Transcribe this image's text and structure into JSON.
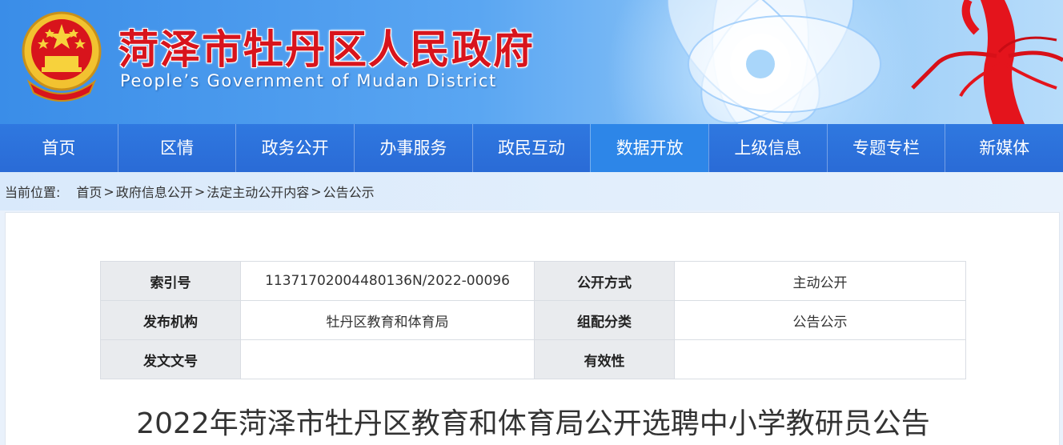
{
  "header": {
    "title": "菏泽市牡丹区人民政府",
    "subtitle": "People’s Government of Mudan District",
    "emblem_icon": "national-emblem-icon",
    "title_color": "#d8141c"
  },
  "nav": {
    "items": [
      {
        "label": "首页"
      },
      {
        "label": "区情"
      },
      {
        "label": "政务公开"
      },
      {
        "label": "办事服务"
      },
      {
        "label": "政民互动"
      },
      {
        "label": "数据开放"
      },
      {
        "label": "上级信息"
      },
      {
        "label": "专题专栏"
      },
      {
        "label": "新媒体"
      }
    ],
    "active_index": 5,
    "bg_color": "#2a6bd6"
  },
  "breadcrumb": {
    "label": "当前位置:",
    "items": [
      "首页",
      "政府信息公开",
      "法定主动公开内容",
      "公告公示"
    ],
    "separator": ">"
  },
  "meta": {
    "index_no_label": "索引号",
    "index_no_value": "11371702004480136N/2022-00096",
    "disclosure_label": "公开方式",
    "disclosure_value": "主动公开",
    "publisher_label": "发布机构",
    "publisher_value": "牡丹区教育和体育局",
    "category_label": "组配分类",
    "category_value": "公告公示",
    "doc_no_label": "发文文号",
    "doc_no_value": "",
    "validity_label": "有效性",
    "validity_value": ""
  },
  "document": {
    "title": "2022年菏泽市牡丹区教育和体育局公开选聘中小学教研员公告"
  }
}
